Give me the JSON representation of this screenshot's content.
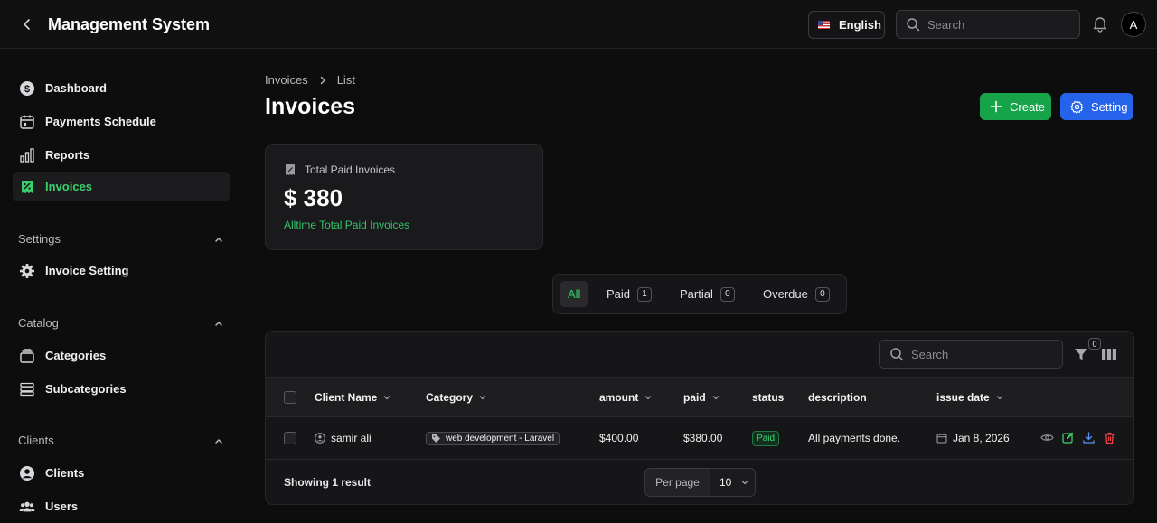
{
  "app": {
    "title": "Management System"
  },
  "header": {
    "language": "English",
    "search_placeholder": "Search",
    "avatar_initial": "A"
  },
  "sidebar": {
    "items": [
      {
        "label": "Dashboard",
        "icon": "dollar-circle-icon"
      },
      {
        "label": "Payments Schedule",
        "icon": "calendar-icon"
      },
      {
        "label": "Reports",
        "icon": "bar-chart-icon"
      },
      {
        "label": "Invoices",
        "icon": "receipt-icon",
        "active": true
      }
    ],
    "groups": [
      {
        "label": "Settings",
        "items": [
          {
            "label": "Invoice Setting",
            "icon": "gear-icon"
          }
        ]
      },
      {
        "label": "Catalog",
        "items": [
          {
            "label": "Categories",
            "icon": "stack-icon"
          },
          {
            "label": "Subcategories",
            "icon": "list-icon"
          }
        ]
      },
      {
        "label": "Clients",
        "items": [
          {
            "label": "Clients",
            "icon": "user-circle-icon"
          },
          {
            "label": "Users",
            "icon": "users-icon"
          }
        ]
      }
    ]
  },
  "breadcrumb": {
    "items": [
      "Invoices",
      "List"
    ]
  },
  "page": {
    "title": "Invoices",
    "create_label": "Create",
    "setting_label": "Setting"
  },
  "stat": {
    "label": "Total Paid Invoices",
    "value": "$ 380",
    "sub": "Alltime Total Paid Invoices"
  },
  "tabs": [
    {
      "label": "All",
      "active": true
    },
    {
      "label": "Paid",
      "count": "1"
    },
    {
      "label": "Partial",
      "count": "0"
    },
    {
      "label": "Overdue",
      "count": "0"
    }
  ],
  "table": {
    "search_placeholder": "Search",
    "filter_count": "0",
    "columns": [
      "Client Name",
      "Category",
      "amount",
      "paid",
      "status",
      "description",
      "issue date"
    ],
    "rows": [
      {
        "client": "samir ali",
        "category": "web development - Laravel",
        "amount": "$400.00",
        "paid": "$380.00",
        "status": "Paid",
        "description": "All payments done.",
        "issue_date": "Jan 8, 2026"
      }
    ],
    "footer": {
      "showing": "Showing 1 result",
      "per_page_label": "Per page",
      "per_page_value": "10"
    }
  },
  "colors": {
    "accent_green": "#16a34a",
    "accent_blue": "#2563eb",
    "active_text": "#3ccf6e",
    "danger": "#ef4444"
  }
}
